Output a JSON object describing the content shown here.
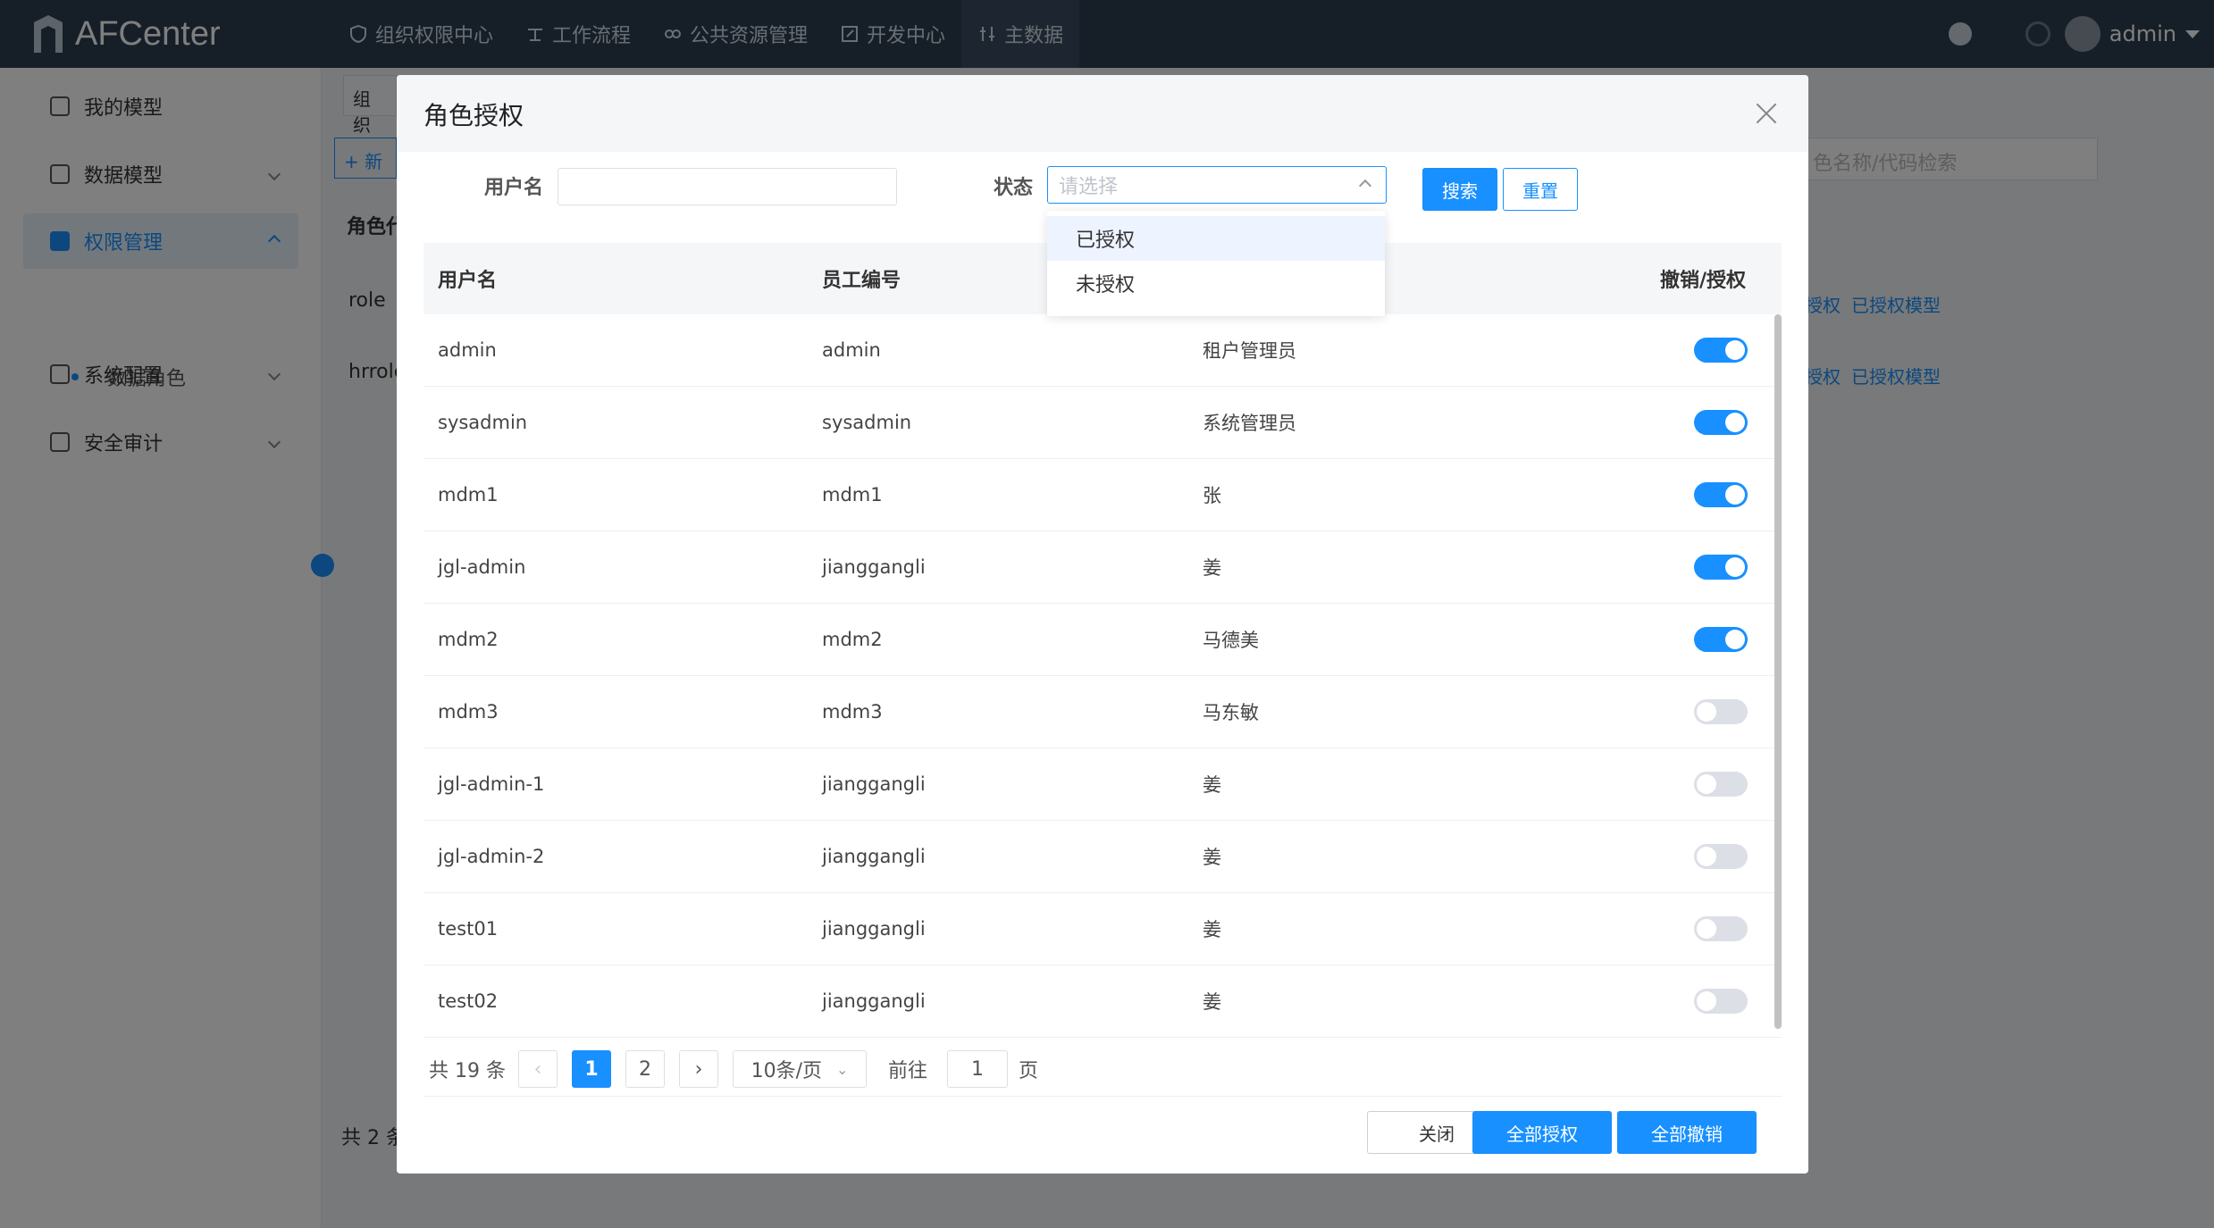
{
  "app": {
    "logo": "AFCenter"
  },
  "nav": [
    {
      "label": "组织权限中心",
      "icon": "shield-icon"
    },
    {
      "label": "工作流程",
      "icon": "flow-icon"
    },
    {
      "label": "公共资源管理",
      "icon": "resource-icon"
    },
    {
      "label": "开发中心",
      "icon": "edit-icon"
    },
    {
      "label": "主数据",
      "icon": "data-icon"
    }
  ],
  "user": {
    "name": "admin"
  },
  "sidebar": {
    "items": [
      {
        "label": "我的模型"
      },
      {
        "label": "数据模型"
      },
      {
        "label": "权限管理"
      },
      {
        "label": "系统配置"
      },
      {
        "label": "安全审计"
      }
    ],
    "sub": {
      "label": "数据角色"
    }
  },
  "bg": {
    "tab": "组织",
    "new_btn": "+ 新",
    "head": "角色代",
    "row1": "role",
    "row2": "hrrole",
    "search_placeholder": "色名称/代码检索",
    "link_a": "授权",
    "link_b": "已授权模型",
    "total": "共 2 条"
  },
  "modal": {
    "title": "角色授权",
    "form": {
      "username_label": "用户名",
      "username_value": "",
      "status_label": "状态",
      "status_placeholder": "请选择",
      "search_btn": "搜索",
      "reset_btn": "重置"
    },
    "dropdown": [
      "已授权",
      "未授权"
    ],
    "table": {
      "headers": [
        "用户名",
        "员工编号",
        "",
        "撤销/授权"
      ],
      "rows": [
        {
          "username": "admin",
          "employee_no": "admin",
          "name": "租户管理员",
          "authorized": true
        },
        {
          "username": "sysadmin",
          "employee_no": "sysadmin",
          "name": "系统管理员",
          "authorized": true
        },
        {
          "username": "mdm1",
          "employee_no": "mdm1",
          "name": "张",
          "authorized": true
        },
        {
          "username": "jgl-admin",
          "employee_no": "jianggangli",
          "name": "姜",
          "authorized": true
        },
        {
          "username": "mdm2",
          "employee_no": "mdm2",
          "name": "马德美",
          "authorized": true
        },
        {
          "username": "mdm3",
          "employee_no": "mdm3",
          "name": "马东敏",
          "authorized": false
        },
        {
          "username": "jgl-admin-1",
          "employee_no": "jianggangli",
          "name": "姜",
          "authorized": false
        },
        {
          "username": "jgl-admin-2",
          "employee_no": "jianggangli",
          "name": "姜",
          "authorized": false
        },
        {
          "username": "test01",
          "employee_no": "jianggangli",
          "name": "姜",
          "authorized": false
        },
        {
          "username": "test02",
          "employee_no": "jianggangli",
          "name": "姜",
          "authorized": false
        }
      ]
    },
    "pagination": {
      "total": "共 19 条",
      "pages": [
        "1",
        "2"
      ],
      "page_size": "10条/页",
      "goto_label": "前往",
      "goto_value": "1",
      "page_unit": "页"
    },
    "footer": {
      "close": "关闭",
      "grant_all": "全部授权",
      "revoke_all": "全部撤销"
    }
  },
  "colors": {
    "primary": "#1890ff",
    "topbar": "#2d3e50"
  }
}
